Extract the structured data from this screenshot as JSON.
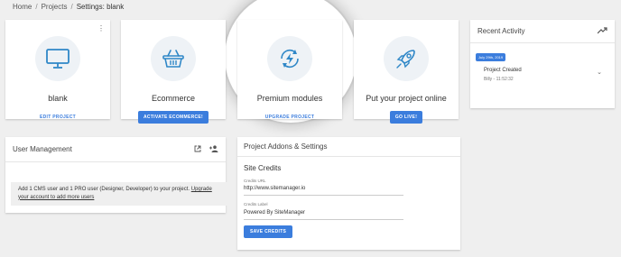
{
  "breadcrumb": {
    "home": "Home",
    "projects": "Projects",
    "current": "Settings: blank",
    "separator": "/"
  },
  "tiles": [
    {
      "title": "blank",
      "button": "EDIT PROJECT",
      "icon": "monitor-icon"
    },
    {
      "title": "Ecommerce",
      "button": "ACTIVATE ECOMMERCE!",
      "icon": "shopping-basket-icon"
    },
    {
      "title": "Premium modules",
      "button": "UPGRADE PROJECT",
      "icon": "premium-modules-icon"
    },
    {
      "title": "Put your project online",
      "button": "GO LIVE!",
      "icon": "rocket-icon"
    }
  ],
  "recent_activity": {
    "title": "Recent Activity",
    "date_badge": "July 29th, 2019",
    "item_title": "Project Created",
    "item_meta": "Billy - 11:52:32"
  },
  "user_management": {
    "title": "User Management",
    "info_text": "Add 1 CMS user and 1 PRO user (Designer, Developer) to your project. ",
    "info_link": "Upgrade your account to add more users"
  },
  "addons": {
    "title": "Project Addons & Settings",
    "section": "Site Credits",
    "url_label": "Credits URL",
    "url_value": "http://www.sitemanager.io",
    "label_label": "Credits Label",
    "label_value": "Powered By SiteManager",
    "save_button": "SAVE CREDITS"
  },
  "colors": {
    "accent": "#3b7ddd",
    "icon_bg": "#eef2f6",
    "page_bg": "#efefef"
  }
}
